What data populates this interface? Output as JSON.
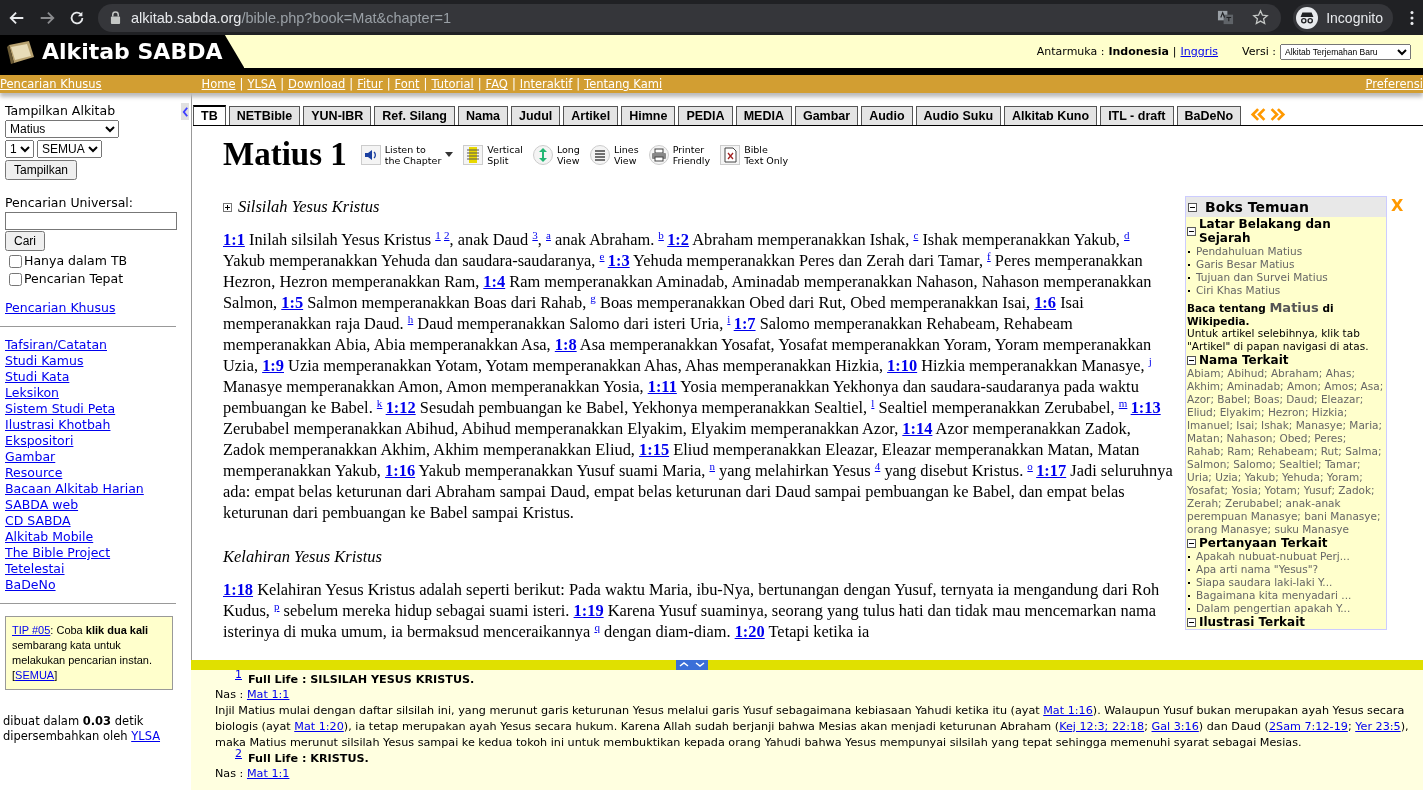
{
  "browser": {
    "url_host": "alkitab.sabda.org",
    "url_path": "/bible.php?book=Mat&chapter=1",
    "profile": "Incognito"
  },
  "header": {
    "logo": "Alkitab SABDA",
    "interface_label": "Antarmuka :",
    "interface_current": "Indonesia",
    "separator": "|",
    "interface_other": "Inggris",
    "version_label": "Versi :",
    "version_value": "Alkitab Terjemahan Baru"
  },
  "nav": {
    "left": "Pencarian Khusus",
    "separator": "|",
    "links": [
      "Home",
      "YLSA",
      "Download",
      "Fitur",
      "Font",
      "Tutorial",
      "FAQ",
      "Interaktif",
      "Tentang Kami"
    ],
    "right": "Preferensi"
  },
  "sidebar": {
    "show_label": "Tampilkan Alkitab",
    "book": "Matius",
    "chapter": "1",
    "verse": "SEMUA",
    "show_button": "Tampilkan",
    "search_label": "Pencarian Universal:",
    "search_button": "Cari",
    "options": [
      {
        "label": "Hanya dalam TB",
        "checked": false
      },
      {
        "label": "Pencarian Tepat",
        "checked": false
      }
    ],
    "special_link": "Pencarian Khusus",
    "links": [
      "Tafsiran/Catatan",
      "Studi Kamus",
      "Studi Kata",
      "Leksikon",
      "Sistem Studi Peta",
      "Ilustrasi Khotbah",
      "Ekspositori",
      "Gambar",
      "Resource",
      "Bacaan Alkitab Harian",
      "SABDA web",
      "CD SABDA",
      "Alkitab Mobile",
      "The Bible Project",
      "Tetelestai",
      "BaDeNo"
    ],
    "tip": [
      {
        "kind": "link",
        "text": "TIP #05"
      },
      {
        "kind": "text",
        "text": ": Coba "
      },
      {
        "kind": "bold",
        "text": "klik dua kali"
      },
      {
        "kind": "text",
        "text": " sembarang kata untuk melakukan pencarian instan. ["
      },
      {
        "kind": "link",
        "text": "SEMUA"
      },
      {
        "kind": "text",
        "text": "]"
      }
    ],
    "footer": [
      {
        "kind": "text",
        "text": "dibuat dalam "
      },
      {
        "kind": "bold",
        "text": "0.03"
      },
      {
        "kind": "text",
        "text": " detik dipersembahkan oleh "
      },
      {
        "kind": "link",
        "text": "YLSA"
      }
    ]
  },
  "tabs": [
    {
      "label": "TB",
      "selected": true
    },
    {
      "label": "NETBible",
      "selected": false
    },
    {
      "label": "YUN-IBR",
      "selected": false
    },
    {
      "label": "Ref. Silang",
      "selected": false
    },
    {
      "label": "Nama",
      "selected": false
    },
    {
      "label": "Judul",
      "selected": false
    },
    {
      "label": "Artikel",
      "selected": false
    },
    {
      "label": "Himne",
      "selected": false
    },
    {
      "label": "PEDIA",
      "selected": false
    },
    {
      "label": "MEDIA",
      "selected": false
    },
    {
      "label": "Gambar",
      "selected": false
    },
    {
      "label": "Audio",
      "selected": false
    },
    {
      "label": "Audio Suku",
      "selected": false
    },
    {
      "label": "Alkitab Kuno",
      "selected": false
    },
    {
      "label": "ITL - draft",
      "selected": false
    },
    {
      "label": "BaDeNo",
      "selected": false
    }
  ],
  "chapter_title": "Matius 1",
  "tools": [
    {
      "kind": "speaker",
      "lines": [
        "Listen to",
        "the Chapter"
      ],
      "dropdown": true
    },
    {
      "kind": "split",
      "lines": [
        "Vertical",
        "Split"
      ],
      "dropdown": false
    },
    {
      "kind": "long",
      "lines": [
        "Long",
        "View"
      ],
      "dropdown": false
    },
    {
      "kind": "lines",
      "lines": [
        "Lines",
        "View"
      ],
      "dropdown": false
    },
    {
      "kind": "printer",
      "lines": [
        "Printer",
        "Friendly"
      ],
      "dropdown": false
    },
    {
      "kind": "text",
      "lines": [
        "Bible",
        "Text Only"
      ],
      "dropdown": false
    }
  ],
  "sections": [
    {
      "heading": "Silsilah Yesus Kristus",
      "collapsible": true,
      "segments": [
        {
          "kind": "verse",
          "text": "1:1"
        },
        {
          "kind": "text",
          "text": " Inilah silsilah Yesus Kristus "
        },
        {
          "kind": "note",
          "text": "1"
        },
        {
          "kind": "note",
          "text": "2"
        },
        {
          "kind": "text",
          "text": ", anak Daud "
        },
        {
          "kind": "note",
          "text": "3"
        },
        {
          "kind": "text",
          "text": ", "
        },
        {
          "kind": "note",
          "text": "a"
        },
        {
          "kind": "text",
          "text": " anak Abraham. "
        },
        {
          "kind": "note",
          "text": "b"
        },
        {
          "kind": "verse",
          "text": "1:2"
        },
        {
          "kind": "text",
          "text": " Abraham memperanakkan Ishak, "
        },
        {
          "kind": "note",
          "text": "c"
        },
        {
          "kind": "text",
          "text": " Ishak memperanakkan Yakub, "
        },
        {
          "kind": "note",
          "text": "d"
        },
        {
          "kind": "text",
          "text": " Yakub memperanakkan Yehuda dan saudara-saudaranya, "
        },
        {
          "kind": "note",
          "text": "e"
        },
        {
          "kind": "verse",
          "text": "1:3"
        },
        {
          "kind": "text",
          "text": " Yehuda memperanakkan Peres dan Zerah dari Tamar, "
        },
        {
          "kind": "note",
          "text": "f"
        },
        {
          "kind": "text",
          "text": " Peres memperanakkan Hezron, Hezron memperanakkan Ram, "
        },
        {
          "kind": "verse",
          "text": "1:4"
        },
        {
          "kind": "text",
          "text": " Ram memperanakkan Aminadab, Aminadab memperanakkan Nahason, Nahason memperanakkan Salmon, "
        },
        {
          "kind": "verse",
          "text": "1:5"
        },
        {
          "kind": "text",
          "text": " Salmon memperanakkan Boas dari Rahab, "
        },
        {
          "kind": "note",
          "text": "g"
        },
        {
          "kind": "text",
          "text": " Boas memperanakkan Obed dari Rut, Obed memperanakkan Isai, "
        },
        {
          "kind": "verse",
          "text": "1:6"
        },
        {
          "kind": "text",
          "text": " Isai memperanakkan raja Daud. "
        },
        {
          "kind": "note",
          "text": "h"
        },
        {
          "kind": "text",
          "text": " Daud memperanakkan Salomo dari isteri Uria, "
        },
        {
          "kind": "note",
          "text": "i"
        },
        {
          "kind": "verse",
          "text": "1:7"
        },
        {
          "kind": "text",
          "text": " Salomo memperanakkan Rehabeam, Rehabeam memperanakkan Abia, Abia memperanakkan Asa, "
        },
        {
          "kind": "verse",
          "text": "1:8"
        },
        {
          "kind": "text",
          "text": " Asa memperanakkan Yosafat, Yosafat memperanakkan Yoram, Yoram memperanakkan Uzia, "
        },
        {
          "kind": "verse",
          "text": "1:9"
        },
        {
          "kind": "text",
          "text": " Uzia memperanakkan Yotam, Yotam memperanakkan Ahas, Ahas memperanakkan Hizkia, "
        },
        {
          "kind": "verse",
          "text": "1:10"
        },
        {
          "kind": "text",
          "text": " Hizkia memperanakkan Manasye, "
        },
        {
          "kind": "note",
          "text": "j"
        },
        {
          "kind": "text",
          "text": " Manasye memperanakkan Amon, Amon memperanakkan Yosia, "
        },
        {
          "kind": "verse",
          "text": "1:11"
        },
        {
          "kind": "text",
          "text": " Yosia memperanakkan Yekhonya dan saudara-saudaranya pada waktu pembuangan ke Babel. "
        },
        {
          "kind": "note",
          "text": "k"
        },
        {
          "kind": "verse",
          "text": "1:12"
        },
        {
          "kind": "text",
          "text": " Sesudah pembuangan ke Babel, Yekhonya memperanakkan Sealtiel, "
        },
        {
          "kind": "note",
          "text": "l"
        },
        {
          "kind": "text",
          "text": " Sealtiel memperanakkan Zerubabel, "
        },
        {
          "kind": "note",
          "text": "m"
        },
        {
          "kind": "verse",
          "text": "1:13"
        },
        {
          "kind": "text",
          "text": " Zerubabel memperanakkan Abihud, Abihud memperanakkan Elyakim, Elyakim memperanakkan Azor, "
        },
        {
          "kind": "verse",
          "text": "1:14"
        },
        {
          "kind": "text",
          "text": " Azor memperanakkan Zadok, Zadok memperanakkan Akhim, Akhim memperanakkan Eliud, "
        },
        {
          "kind": "verse",
          "text": "1:15"
        },
        {
          "kind": "text",
          "text": " Eliud memperanakkan Eleazar, Eleazar memperanakkan Matan, Matan memperanakkan Yakub, "
        },
        {
          "kind": "verse",
          "text": "1:16"
        },
        {
          "kind": "text",
          "text": " Yakub memperanakkan Yusuf suami Maria, "
        },
        {
          "kind": "note",
          "text": "n"
        },
        {
          "kind": "text",
          "text": " yang melahirkan Yesus "
        },
        {
          "kind": "note",
          "text": "4"
        },
        {
          "kind": "text",
          "text": " yang disebut Kristus. "
        },
        {
          "kind": "note",
          "text": "o"
        },
        {
          "kind": "verse",
          "text": "1:17"
        },
        {
          "kind": "text",
          "text": " Jadi seluruhnya ada: empat belas keturunan dari Abraham sampai Daud, empat belas keturunan dari Daud sampai pembuangan ke Babel, dan empat belas keturunan dari pembuangan ke Babel sampai Kristus."
        }
      ]
    },
    {
      "heading": "Kelahiran Yesus Kristus",
      "collapsible": false,
      "segments": [
        {
          "kind": "verse",
          "text": "1:18"
        },
        {
          "kind": "text",
          "text": " Kelahiran Yesus Kristus adalah seperti berikut: Pada waktu Maria, ibu-Nya, bertunangan dengan Yusuf, ternyata ia mengandung dari Roh Kudus, "
        },
        {
          "kind": "note",
          "text": "p"
        },
        {
          "kind": "text",
          "text": " sebelum mereka hidup sebagai suami isteri. "
        },
        {
          "kind": "verse",
          "text": "1:19"
        },
        {
          "kind": "text",
          "text": " Karena Yusuf suaminya, seorang yang tulus hati dan tidak mau mencemarkan nama isterinya di muka umum, ia bermaksud menceraikannya "
        },
        {
          "kind": "note",
          "text": "q"
        },
        {
          "kind": "text",
          "text": " dengan diam-diam. "
        },
        {
          "kind": "verse",
          "text": "1:20"
        },
        {
          "kind": "text",
          "text": " Tetapi ketika ia"
        }
      ]
    }
  ],
  "finder": {
    "title": "Boks Temuan",
    "close": "X",
    "groups": [
      {
        "heading": "Latar Belakang dan Sejarah",
        "items": [
          "Pendahuluan Matius",
          "Garis Besar Matius",
          "Tujuan dan Survei Matius",
          "Ciri Khas Matius"
        ],
        "wiki": [
          {
            "kind": "bold",
            "text": "Baca tentang "
          },
          {
            "kind": "link",
            "text": "Matius"
          },
          {
            "kind": "bold",
            "text": " di Wikipedia."
          }
        ],
        "note": "Untuk artikel selebihnya, klik tab \"Artikel\" di papan navigasi di atas."
      },
      {
        "heading": "Nama Terkait",
        "names": "Abiam; Abihud; Abraham; Ahas; Akhim; Aminadab; Amon; Amos; Asa; Azor; Babel; Boas; Daud; Eleazar; Eliud; Elyakim; Hezron; Hizkia; Imanuel; Isai; Ishak; Manasye; Maria; Matan; Nahason; Obed; Peres; Rahab; Ram; Rehabeam; Rut; Salma; Salmon; Salomo; Sealtiel; Tamar; Uria; Uzia; Yakub; Yehuda; Yoram; Yosafat; Yosia; Yotam; Yusuf; Zadok; Zerah; Zerubabel; anak-anak perempuan Manasye; bani Manasye; orang Manasye; suku Manasye"
      },
      {
        "heading": "Pertanyaan Terkait",
        "items": [
          "Apakah nubuat-nubuat Perj...",
          "Apa arti nama \"Yesus\"?",
          "Siapa saudara laki-laki Y...",
          "Bagaimana kita menyadari ...",
          "Dalam pengertian apakah Y..."
        ]
      },
      {
        "heading": "Ilustrasi Terkait"
      }
    ]
  },
  "footnotes": [
    {
      "mark": "1",
      "title": "Full Life : SILSILAH YESUS KRISTUS.",
      "nas_label": "Nas :",
      "nas": "Mat 1:1",
      "body": [
        {
          "kind": "text",
          "text": "Injil Matius mulai dengan daftar silsilah ini, yang merunut garis keturunan Yesus melalui garis Yusuf sebagaimana kebiasaan Yahudi ketika itu (ayat "
        },
        {
          "kind": "link",
          "text": "Mat 1:16"
        },
        {
          "kind": "text",
          "text": "). Walaupun Yusuf bukan merupakan ayah Yesus secara biologis (ayat "
        },
        {
          "kind": "link",
          "text": "Mat 1:20"
        },
        {
          "kind": "text",
          "text": "), ia tetap merupakan ayah Yesus secara hukum. Karena Allah sudah berjanji bahwa Mesias akan menjadi keturunan Abraham ("
        },
        {
          "kind": "link",
          "text": "Kej 12:3; 22:18"
        },
        {
          "kind": "text",
          "text": "; "
        },
        {
          "kind": "link",
          "text": "Gal 3:16"
        },
        {
          "kind": "text",
          "text": ") dan Daud ("
        },
        {
          "kind": "link",
          "text": "2Sam 7:12-19"
        },
        {
          "kind": "text",
          "text": "; "
        },
        {
          "kind": "link",
          "text": "Yer 23:5"
        },
        {
          "kind": "text",
          "text": "), maka Matius merunut silsilah Yesus sampai ke kedua tokoh ini untuk membuktikan kepada orang Yahudi bahwa Yesus mempunyai silsilah yang tepat sehingga memenuhi syarat sebagai Mesias."
        }
      ]
    },
    {
      "mark": "2",
      "title": "Full Life : KRISTUS.",
      "nas_label": "Nas :",
      "nas": "Mat 1:1"
    }
  ]
}
